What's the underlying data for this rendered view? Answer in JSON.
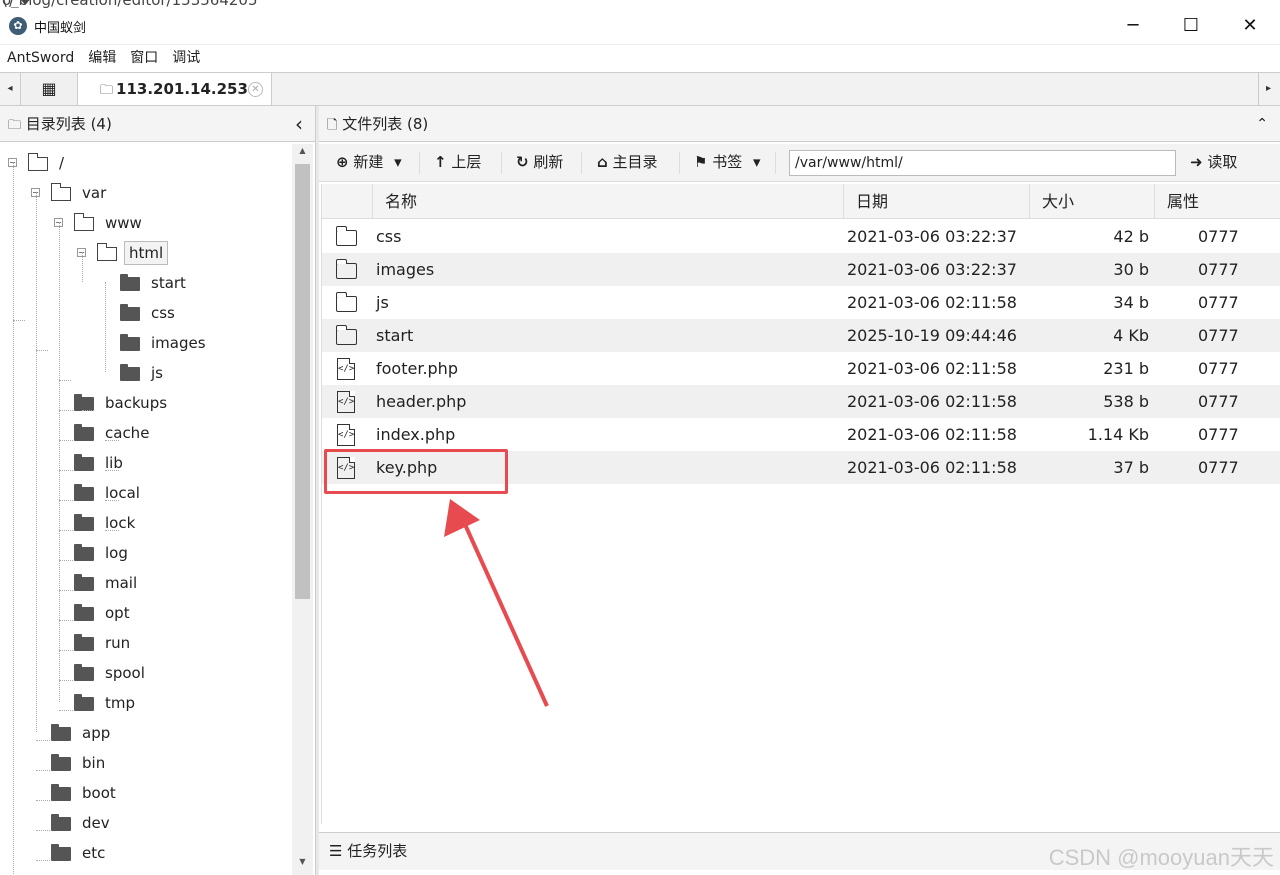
{
  "browser": {
    "url_fragment": "o_blog/creation/editor/153564205",
    "right_glyph": "⟨⟩ ♥"
  },
  "window": {
    "title": "中国蚁剑",
    "icon_glyph": "✿",
    "min": "─",
    "max": "☐",
    "close": "✕"
  },
  "menu": [
    "AntSword",
    "编辑",
    "窗口",
    "调试"
  ],
  "tabs": {
    "left_arrow": "◂",
    "right_arrow": "▸",
    "grid_glyph": "▦",
    "host_label": "113.201.14.253",
    "host_glyph": "🗀",
    "close_glyph": "✕"
  },
  "left": {
    "header": "目录列表 (4)",
    "collapse_glyph": "‹",
    "tree": [
      {
        "label": "/",
        "type": "open",
        "toggle": "−"
      },
      {
        "label": "var",
        "type": "open",
        "toggle": "−"
      },
      {
        "label": "www",
        "type": "open",
        "toggle": "−"
      },
      {
        "label": "html",
        "type": "open",
        "toggle": "−",
        "selected": true
      },
      {
        "label": "start",
        "type": "filled"
      },
      {
        "label": "css",
        "type": "filled"
      },
      {
        "label": "images",
        "type": "filled"
      },
      {
        "label": "js",
        "type": "filled"
      },
      {
        "label": "backups",
        "type": "filled"
      },
      {
        "label": "cache",
        "type": "filled"
      },
      {
        "label": "lib",
        "type": "filled"
      },
      {
        "label": "local",
        "type": "filled"
      },
      {
        "label": "lock",
        "type": "filled"
      },
      {
        "label": "log",
        "type": "filled"
      },
      {
        "label": "mail",
        "type": "filled"
      },
      {
        "label": "opt",
        "type": "filled"
      },
      {
        "label": "run",
        "type": "filled"
      },
      {
        "label": "spool",
        "type": "filled"
      },
      {
        "label": "tmp",
        "type": "filled"
      },
      {
        "label": "app",
        "type": "filled"
      },
      {
        "label": "bin",
        "type": "filled"
      },
      {
        "label": "boot",
        "type": "filled"
      },
      {
        "label": "dev",
        "type": "filled"
      },
      {
        "label": "etc",
        "type": "filled"
      }
    ]
  },
  "right": {
    "header": "文件列表 (8)",
    "collapse_glyph": "⌃",
    "toolbar": {
      "new": "新建",
      "new_glyph": "⊕",
      "dropdown": "▾",
      "up": "上层",
      "up_glyph": "↑",
      "refresh": "刷新",
      "refresh_glyph": "↻",
      "home": "主目录",
      "home_glyph": "⌂",
      "bookmark": "书签",
      "bookmark_glyph": "⚑",
      "path": "/var/www/html/",
      "read": "读取",
      "read_glyph": "➜"
    },
    "columns": {
      "name": "名称",
      "date": "日期",
      "size": "大小",
      "attr": "属性"
    },
    "files": [
      {
        "name": "css",
        "date": "2021-03-06 03:22:37",
        "size": "42 b",
        "attr": "0777",
        "kind": "folder"
      },
      {
        "name": "images",
        "date": "2021-03-06 03:22:37",
        "size": "30 b",
        "attr": "0777",
        "kind": "folder"
      },
      {
        "name": "js",
        "date": "2021-03-06 02:11:58",
        "size": "34 b",
        "attr": "0777",
        "kind": "folder"
      },
      {
        "name": "start",
        "date": "2025-10-19 09:44:46",
        "size": "4 Kb",
        "attr": "0777",
        "kind": "folder"
      },
      {
        "name": "footer.php",
        "date": "2021-03-06 02:11:58",
        "size": "231 b",
        "attr": "0777",
        "kind": "file"
      },
      {
        "name": "header.php",
        "date": "2021-03-06 02:11:58",
        "size": "538 b",
        "attr": "0777",
        "kind": "file"
      },
      {
        "name": "index.php",
        "date": "2021-03-06 02:11:58",
        "size": "1.14 Kb",
        "attr": "0777",
        "kind": "file"
      },
      {
        "name": "key.php",
        "date": "2021-03-06 02:11:58",
        "size": "37 b",
        "attr": "0777",
        "kind": "file"
      }
    ],
    "file_glyph": "</>"
  },
  "tasks": {
    "label": "任务列表",
    "glyph": "☰"
  },
  "watermark": "CSDN @mooyuan天天",
  "colors": {
    "highlight": "#e84b4f",
    "arrow": "#e84b4f"
  }
}
